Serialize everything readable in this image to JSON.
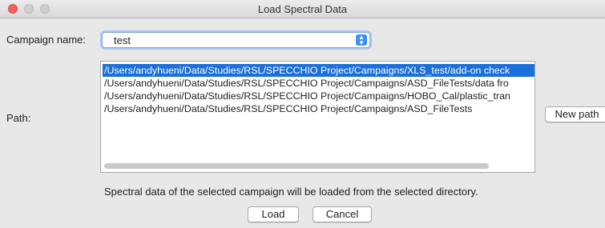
{
  "window": {
    "title": "Load Spectral Data"
  },
  "campaign": {
    "label": "Campaign name:",
    "value": "test"
  },
  "path": {
    "label": "Path:",
    "items": [
      "/Users/andyhueni/Data/Studies/RSL/SPECCHIO Project/Campaigns/XLS_test/add-on check",
      "/Users/andyhueni/Data/Studies/RSL/SPECCHIO Project/Campaigns/ASD_FileTests/data fro",
      "/Users/andyhueni/Data/Studies/RSL/SPECCHIO Project/Campaigns/HOBO_Cal/plastic_tran",
      "/Users/andyhueni/Data/Studies/RSL/SPECCHIO Project/Campaigns/ASD_FileTests"
    ],
    "selected_index": 0,
    "new_path_button": "New path"
  },
  "info_text": "Spectral data of the selected campaign will be loaded from the selected directory.",
  "buttons": {
    "load": "Load",
    "cancel": "Cancel"
  },
  "colors": {
    "selection": "#1a6fd8",
    "close": "#f4605c",
    "focus": "#3d8ef5"
  }
}
